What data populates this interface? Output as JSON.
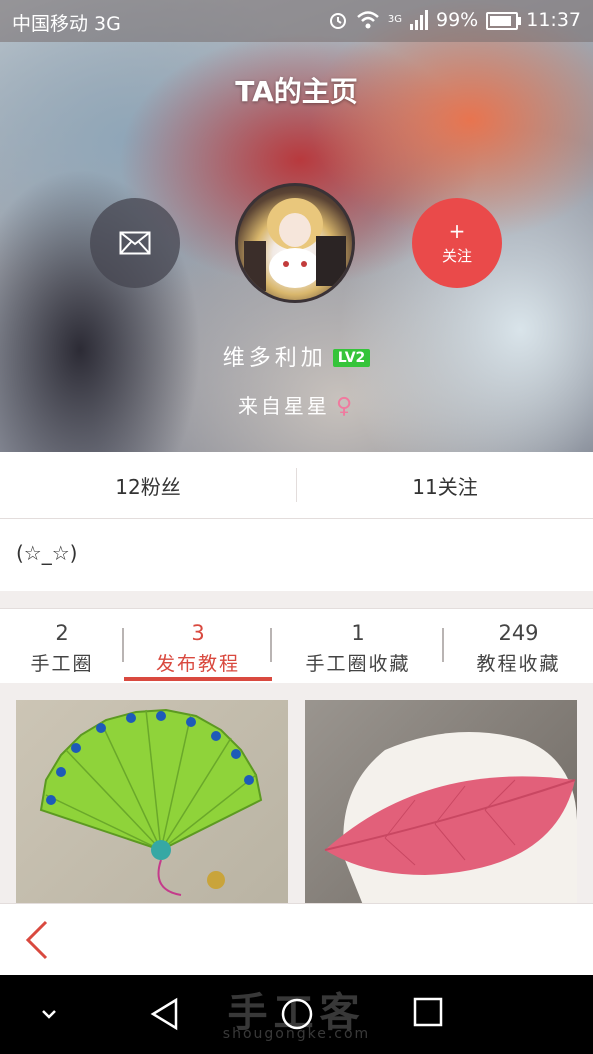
{
  "status_bar": {
    "carrier": "中国移动 3G",
    "network": "3G",
    "battery": "99%",
    "time": "11:37",
    "icons": [
      "alarm-icon",
      "wifi-icon",
      "signal-icon",
      "battery-icon"
    ]
  },
  "profile": {
    "page_title": "TA的主页",
    "username": "维多利加",
    "level": "LV2",
    "location": "来自星星",
    "gender_symbol": "♀",
    "message_icon": "envelope-icon",
    "follow_plus": "+",
    "follow_label": "关注"
  },
  "counts": {
    "fans": "12粉丝",
    "following": "11关注"
  },
  "bio": "(☆_☆)",
  "tabs": [
    {
      "count": "2",
      "label": "手工圈",
      "active": false
    },
    {
      "count": "3",
      "label": "发布教程",
      "active": true
    },
    {
      "count": "1",
      "label": "手工圈收藏",
      "active": false
    },
    {
      "count": "249",
      "label": "教程收藏",
      "active": false
    }
  ],
  "watermark": {
    "main": "手工客",
    "sub": "shougongke.com"
  },
  "colors": {
    "accent": "#d9493f",
    "follow": "#ea4a4a",
    "level_badge": "#35c43a",
    "gender": "#f07a9f"
  }
}
